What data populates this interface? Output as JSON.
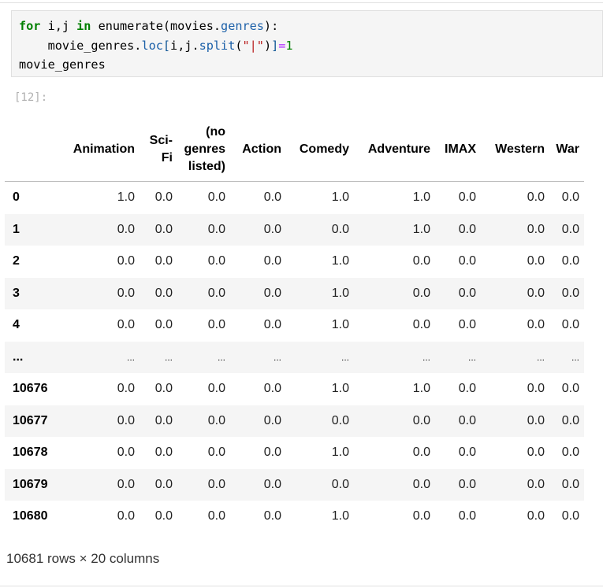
{
  "code": {
    "line1": {
      "kw_for": "for",
      "vars": " i,j ",
      "kw_in": "in",
      "call": " enumerate(movies.",
      "attr": "genres",
      "end": "):"
    },
    "line2": {
      "indent": "    movie_genres.",
      "loc": "loc",
      "lb": "[",
      "args": "i,j.",
      "split": "split",
      "lp": "(",
      "str": "\"|\"",
      "rp": ")",
      "rb": "]",
      "eq": "=",
      "one": "1"
    },
    "line3": "movie_genres"
  },
  "prompt": "[12]:",
  "table": {
    "headers": [
      "Animation",
      "Sci-Fi",
      "(no genres listed)",
      "Action",
      "Comedy",
      "Adventure",
      "IMAX",
      "Western",
      "War"
    ],
    "rows": [
      {
        "index": "0",
        "values": [
          "1.0",
          "0.0",
          "0.0",
          "0.0",
          "1.0",
          "1.0",
          "0.0",
          "0.0",
          "0.0"
        ]
      },
      {
        "index": "1",
        "values": [
          "0.0",
          "0.0",
          "0.0",
          "0.0",
          "0.0",
          "1.0",
          "0.0",
          "0.0",
          "0.0"
        ]
      },
      {
        "index": "2",
        "values": [
          "0.0",
          "0.0",
          "0.0",
          "0.0",
          "1.0",
          "0.0",
          "0.0",
          "0.0",
          "0.0"
        ]
      },
      {
        "index": "3",
        "values": [
          "0.0",
          "0.0",
          "0.0",
          "0.0",
          "1.0",
          "0.0",
          "0.0",
          "0.0",
          "0.0"
        ]
      },
      {
        "index": "4",
        "values": [
          "0.0",
          "0.0",
          "0.0",
          "0.0",
          "1.0",
          "0.0",
          "0.0",
          "0.0",
          "0.0"
        ]
      },
      {
        "index": "...",
        "values": [
          "...",
          "...",
          "...",
          "...",
          "...",
          "...",
          "...",
          "...",
          "..."
        ]
      },
      {
        "index": "10676",
        "values": [
          "0.0",
          "0.0",
          "0.0",
          "0.0",
          "1.0",
          "1.0",
          "0.0",
          "0.0",
          "0.0"
        ]
      },
      {
        "index": "10677",
        "values": [
          "0.0",
          "0.0",
          "0.0",
          "0.0",
          "0.0",
          "0.0",
          "0.0",
          "0.0",
          "0.0"
        ]
      },
      {
        "index": "10678",
        "values": [
          "0.0",
          "0.0",
          "0.0",
          "0.0",
          "1.0",
          "0.0",
          "0.0",
          "0.0",
          "0.0"
        ]
      },
      {
        "index": "10679",
        "values": [
          "0.0",
          "0.0",
          "0.0",
          "0.0",
          "0.0",
          "0.0",
          "0.0",
          "0.0",
          "0.0"
        ]
      },
      {
        "index": "10680",
        "values": [
          "0.0",
          "0.0",
          "0.0",
          "0.0",
          "1.0",
          "0.0",
          "0.0",
          "0.0",
          "0.0"
        ]
      }
    ]
  },
  "summary": "10681 rows × 20 columns"
}
